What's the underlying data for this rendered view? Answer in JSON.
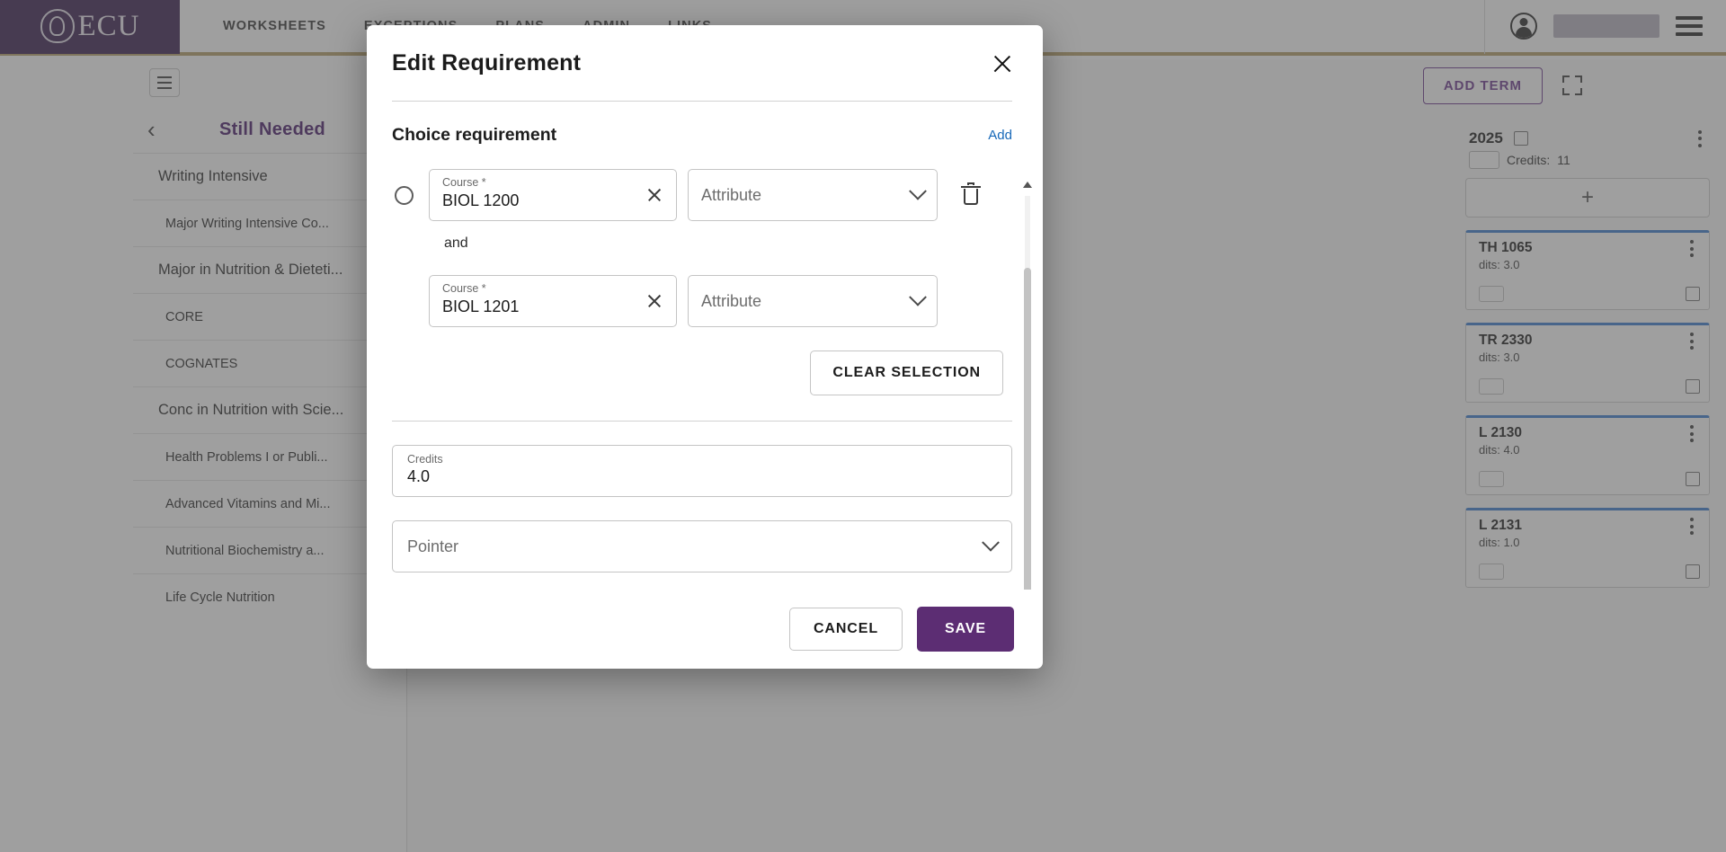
{
  "topnav": {
    "brand_text": "ECU",
    "links": [
      "WORKSHEETS",
      "EXCEPTIONS",
      "PLANS",
      "ADMIN",
      "LINKS"
    ],
    "user_name": ""
  },
  "left_panel": {
    "title": "Still Needed",
    "rows": [
      {
        "label": "Writing Intensive",
        "type": "group",
        "chevron": ""
      },
      {
        "label": "Major Writing Intensive Co...",
        "type": "child",
        "chevron": "›"
      },
      {
        "label": "Major in Nutrition & Dieteti...",
        "type": "group",
        "chevron": ""
      },
      {
        "label": "CORE",
        "type": "child",
        "chevron": "›"
      },
      {
        "label": "COGNATES",
        "type": "child",
        "chevron": "›"
      },
      {
        "label": "Conc in Nutrition with Scie...",
        "type": "group",
        "chevron": ""
      },
      {
        "label": "Health Problems I or Publi...",
        "type": "child",
        "chevron": "›"
      },
      {
        "label": "Advanced Vitamins and Mi...",
        "type": "child",
        "chevron": "›"
      },
      {
        "label": "Nutritional Biochemistry a...",
        "type": "child",
        "chevron": "›"
      },
      {
        "label": "Life Cycle Nutrition",
        "type": "child",
        "chevron": "›"
      }
    ]
  },
  "right_area": {
    "add_term_label": "ADD TERM",
    "term": {
      "name": "2025",
      "credits_label": "Credits:",
      "credits_value": "11",
      "add_card_label": "+"
    },
    "courses": [
      {
        "code": "TH 1065",
        "credits": "dits: 3.0"
      },
      {
        "code": "TR 2330",
        "credits": "dits: 3.0"
      },
      {
        "code": "L 2130",
        "credits": "dits: 4.0"
      },
      {
        "code": "L 2131",
        "credits": "dits: 1.0"
      }
    ]
  },
  "modal": {
    "title": "Edit Requirement",
    "close_label": "×",
    "section": {
      "title": "Choice requirement",
      "add_link": "Add",
      "conjunction": "and"
    },
    "course_rows": [
      {
        "course_label": "Course *",
        "course_value": "BIOL 1200",
        "attribute_placeholder": "Attribute"
      },
      {
        "course_label": "Course *",
        "course_value": "BIOL 1201",
        "attribute_placeholder": "Attribute"
      }
    ],
    "clear_selection_label": "CLEAR SELECTION",
    "credits": {
      "label": "Credits",
      "value": "4.0"
    },
    "pointer": {
      "placeholder": "Pointer"
    },
    "footer": {
      "cancel_label": "CANCEL",
      "save_label": "SAVE"
    }
  },
  "colors": {
    "brand_purple": "#3d2352",
    "accent_gold": "#b5a16b",
    "title_purple": "#4d1f6e",
    "save_purple": "#5c2d73",
    "link_blue": "#1668b8",
    "card_top_blue": "#3f7fd0"
  }
}
